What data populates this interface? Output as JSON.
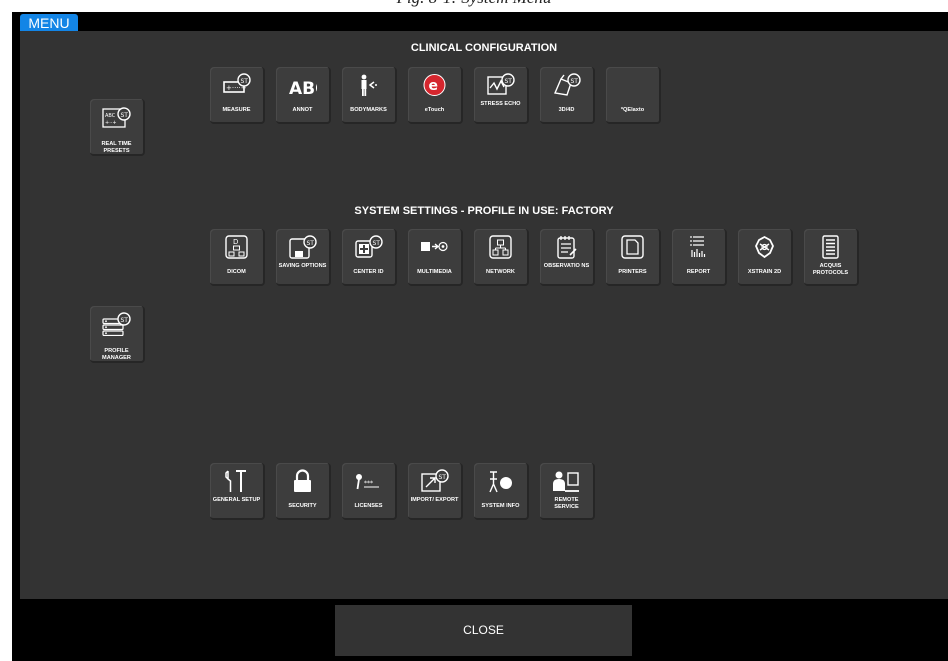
{
  "caption": "Fig. 8-1: System Menu",
  "menu_tab": "MENU",
  "clinical": {
    "title": "CLINICAL CONFIGURATION",
    "tiles": [
      {
        "label": "MEASURE",
        "icon": "measure-icon"
      },
      {
        "label": "ANNOT",
        "icon": "abc-text-icon"
      },
      {
        "label": "BODYMARKS",
        "icon": "bodymark-figure-icon"
      },
      {
        "label": "eTouch",
        "icon": "etouch-icon"
      },
      {
        "label": "STRESS ECHO",
        "icon": "stress-echo-icon"
      },
      {
        "label": "3D/4D",
        "icon": "3d-probe-icon"
      },
      {
        "label": "*QElaxto",
        "icon": "blank-icon"
      }
    ]
  },
  "realtime_presets": {
    "label": "REAL TIME PRESETS",
    "icon": "presets-icon"
  },
  "system_settings": {
    "title": "SYSTEM SETTINGS - PROFILE IN USE: FACTORY",
    "tiles": [
      {
        "label": "DICOM",
        "icon": "dicom-network-icon"
      },
      {
        "label": "SAVING OPTIONS",
        "icon": "save-options-icon"
      },
      {
        "label": "CENTER ID",
        "icon": "center-id-icon"
      },
      {
        "label": "MULTIMEDIA",
        "icon": "multimedia-icon"
      },
      {
        "label": "NETWORK",
        "icon": "network-icon"
      },
      {
        "label": "OBSERVATIO NS",
        "icon": "observations-icon"
      },
      {
        "label": "PRINTERS",
        "icon": "printer-icon"
      },
      {
        "label": "REPORT",
        "icon": "report-icon"
      },
      {
        "label": "XSTRAIN 2D",
        "icon": "xstrain-icon"
      },
      {
        "label": "ACQUIS PROTOCOLS",
        "icon": "protocol-list-icon"
      }
    ]
  },
  "profile_manager": {
    "label": "PROFILE MANAGER",
    "icon": "profile-manager-icon"
  },
  "general": {
    "tiles": [
      {
        "label": "GENERAL SETUP",
        "icon": "tools-icon"
      },
      {
        "label": "SECURITY",
        "icon": "lock-icon"
      },
      {
        "label": "LICENSES",
        "icon": "key-icon"
      },
      {
        "label": "IMPORT/ EXPORT",
        "icon": "import-export-icon"
      },
      {
        "label": "SYSTEM INFO",
        "icon": "system-info-icon"
      },
      {
        "label": "REMOTE SERVICE",
        "icon": "remote-service-icon"
      }
    ]
  },
  "close_label": "CLOSE"
}
